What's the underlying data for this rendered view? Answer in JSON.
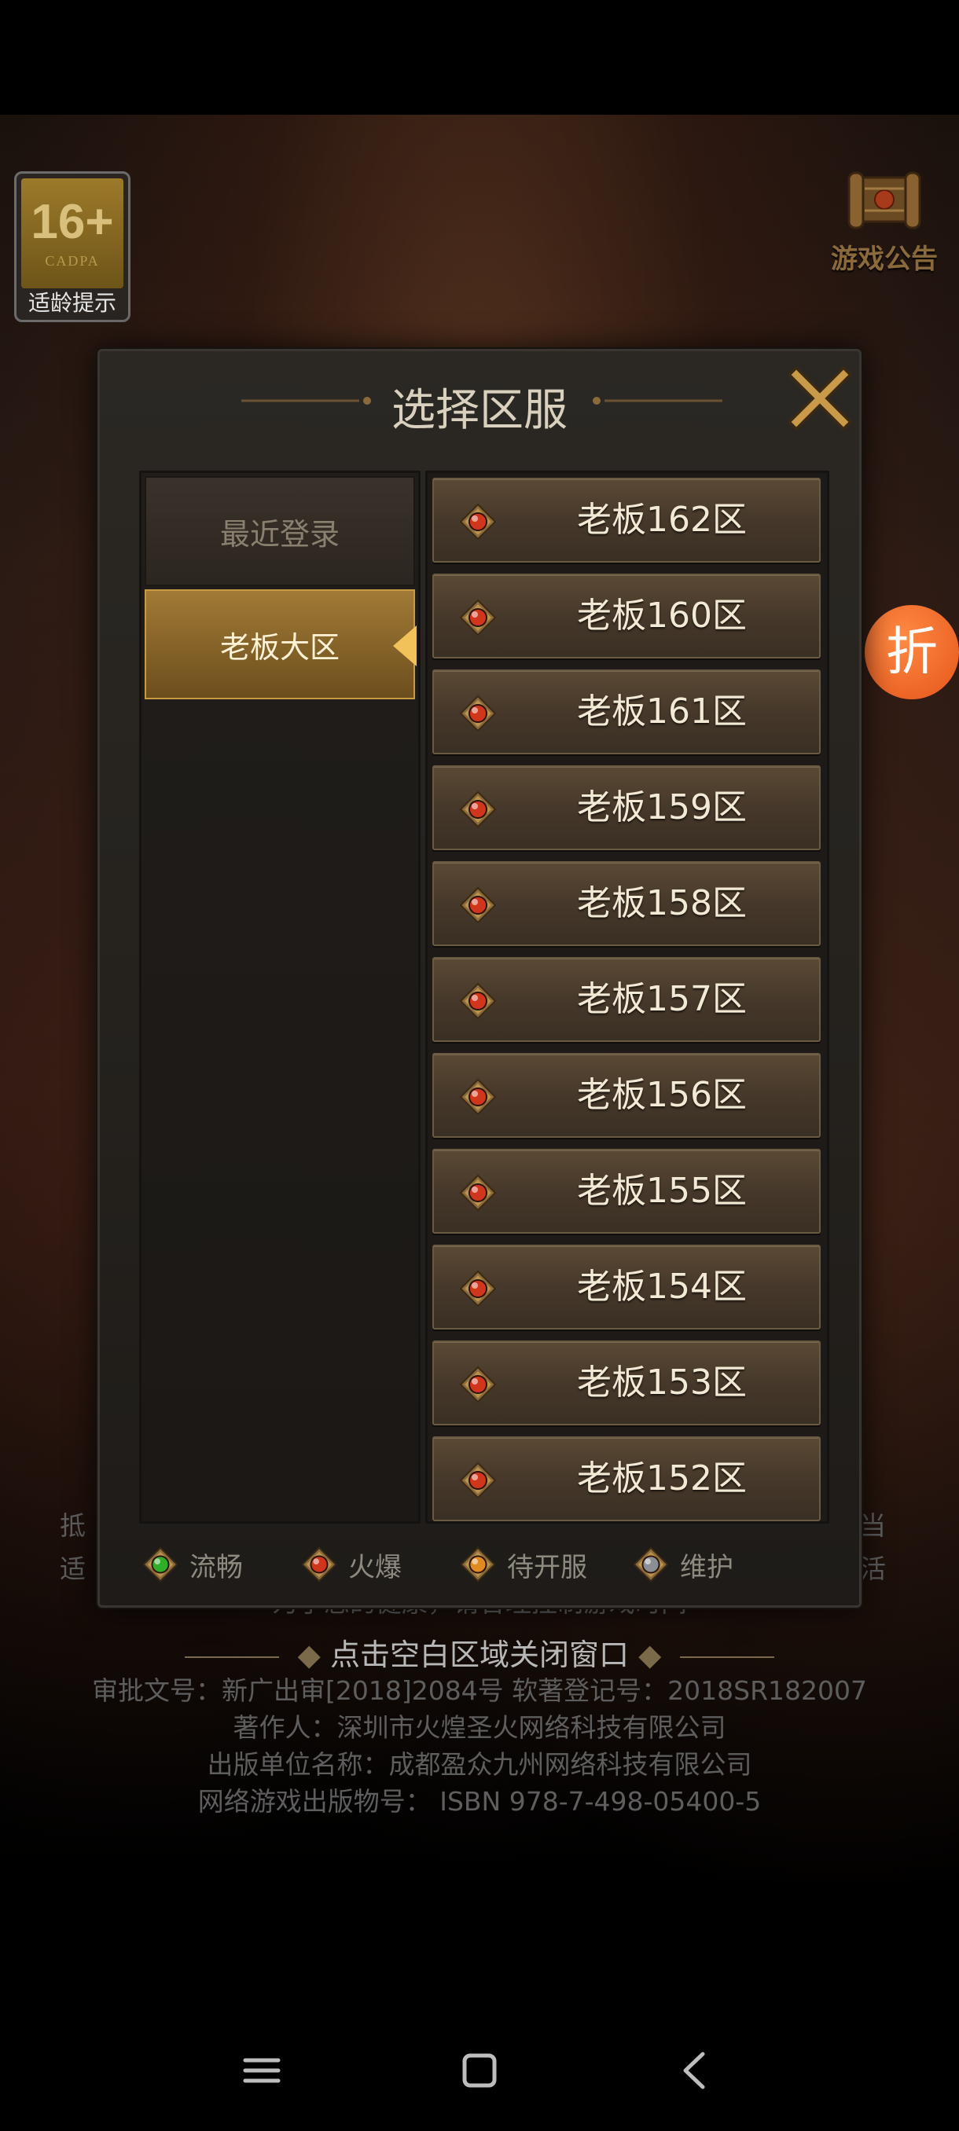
{
  "game": {
    "age_badge": {
      "rating": "16+",
      "org": "CADPA",
      "label": "适龄提示"
    },
    "notice_label": "游戏公告",
    "discount_label": "折"
  },
  "modal": {
    "title": "选择区服",
    "categories": [
      {
        "label": "最近登录",
        "active": false
      },
      {
        "label": "老板大区",
        "active": true
      }
    ],
    "servers": [
      {
        "name": "老板162区",
        "status": "hot"
      },
      {
        "name": "老板160区",
        "status": "hot"
      },
      {
        "name": "老板161区",
        "status": "hot"
      },
      {
        "name": "老板159区",
        "status": "hot"
      },
      {
        "name": "老板158区",
        "status": "hot"
      },
      {
        "name": "老板157区",
        "status": "hot"
      },
      {
        "name": "老板156区",
        "status": "hot"
      },
      {
        "name": "老板155区",
        "status": "hot"
      },
      {
        "name": "老板154区",
        "status": "hot"
      },
      {
        "name": "老板153区",
        "status": "hot"
      },
      {
        "name": "老板152区",
        "status": "hot"
      }
    ],
    "legend": [
      {
        "label": "流畅",
        "color": "#2fae2a"
      },
      {
        "label": "火爆",
        "color": "#d0361c"
      },
      {
        "label": "待开服",
        "color": "#e08a22"
      },
      {
        "label": "维护",
        "color": "#8a8f96"
      }
    ]
  },
  "background": {
    "left_fragment_1": "抵",
    "left_fragment_2": "适",
    "right_fragment_1": "当",
    "right_fragment_2": "活",
    "partial_line": "为了您的健康，请合理控制游戏时间",
    "close_hint": "点击空白区域关闭窗口",
    "approval": "审批文号：新广出审[2018]2084号   软著登记号：2018SR182007",
    "author": "著作人：深圳市火煌圣火网络科技有限公司",
    "publisher": "出版单位名称：成都盈众九州网络科技有限公司",
    "isbn": "网络游戏出版物号： ISBN 978-7-498-05400-5"
  },
  "colors": {
    "hot_gem": "#d0361c",
    "gold_accent": "#c99a44"
  }
}
